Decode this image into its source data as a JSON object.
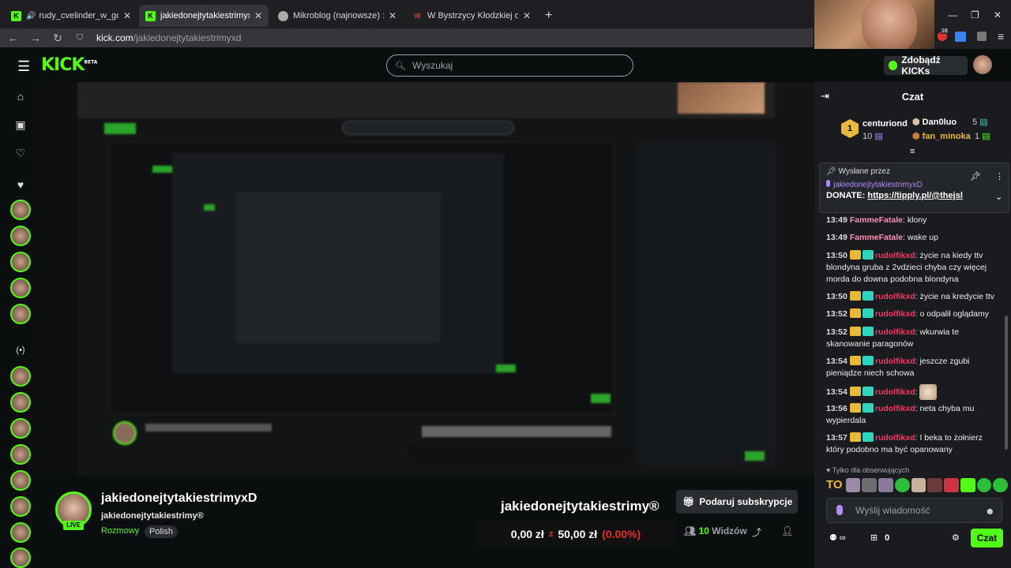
{
  "browser": {
    "tabs": [
      {
        "label": "rudy_cvelinder_w_goglach",
        "close": "✕"
      },
      {
        "label": "jakiedonejtytakiestrimyxD Stream",
        "close": "✕"
      },
      {
        "label": "Mikroblog (najnowsze) :: Wykop",
        "close": "✕"
      },
      {
        "label": "W Bystrzycy Kłodzkiej obowiązy",
        "close": "✕"
      }
    ],
    "new_tab": "+",
    "url_host": "kick.com",
    "url_path": "/jakiedonejtytakiestrimyxd",
    "ext_badge": "16"
  },
  "kick": {
    "logo": "KICK",
    "logo_beta": "BETA",
    "search_placeholder": "Wyszukaj",
    "kicks_button": "Zdobądź KICKs"
  },
  "stream": {
    "channel_name": "jakiedonejtytakiestrimyxD",
    "title": "jakiedonejtytakiestrimy®",
    "category": "Rozmowy",
    "tag": "Polish",
    "live_badge": "LIVE",
    "overlay_name": "jakiedonejtytakiestrimy®",
    "sub_button": "Podaruj subskrypcje",
    "donation_current": "0,00 zł",
    "donation_sep": "z",
    "donation_goal": "50,00 zł",
    "donation_pct": "(0.00%)",
    "viewers_count": "10",
    "viewers_label": "Widzów"
  },
  "chat": {
    "title": "Czat",
    "gifters": {
      "first": {
        "rank": "1",
        "name": "centuriond",
        "count": "10"
      },
      "second": {
        "name": "Dan0luo",
        "count": "5"
      },
      "third": {
        "name": "fan_minoka",
        "count": "1"
      }
    },
    "pinned": {
      "label": "Wysłane przez",
      "user": "jakiedonejtytakiestrimyxD",
      "text_prefix": "DONATE: ",
      "link": "https://tipply.pl/@thejsl"
    },
    "messages": [
      {
        "time": "13:49",
        "user": "FammeFatale",
        "text": ": klony"
      },
      {
        "time": "13:49",
        "user": "FammeFatale",
        "text": ": wake up"
      },
      {
        "time": "13:50",
        "user": "rudolfikxd",
        "text": ": życie na kiedy ttv blondyna gruba z 2vdzieci chyba czy więcej morda do downa podobna blondyna"
      },
      {
        "time": "13:50",
        "user": "rudolfikxd",
        "text": ": życie na kredycie ttv"
      },
      {
        "time": "13:52",
        "user": "rudolfikxd",
        "text": ": o odpalił oglądamy"
      },
      {
        "time": "13:52",
        "user": "rudolfikxd",
        "text": ": wkurwia te skanowanie paragonów"
      },
      {
        "time": "13:54",
        "user": "rudolfikxd",
        "text": ": jeszcze zgubi pieniądze niech schowa"
      },
      {
        "time": "13:54",
        "user": "rudolfikxd",
        "text": ":"
      },
      {
        "time": "13:56",
        "user": "rudolfikxd",
        "text": ": neta chyba mu wypierdala"
      },
      {
        "time": "13:57",
        "user": "rudolfikxd",
        "text": ": I beka to żołnierz który podobno ma być opanowany"
      }
    ],
    "followers_only": "Tylko dla obserwujących",
    "emote_prefix": "TO",
    "input_placeholder": "Wyślij wiadomość",
    "footer_count": "0",
    "send_button": "Czat"
  },
  "colors": {
    "brand": "#53fc18",
    "chat_bg": "#191b1f",
    "page_bg": "#0b0e0f"
  }
}
